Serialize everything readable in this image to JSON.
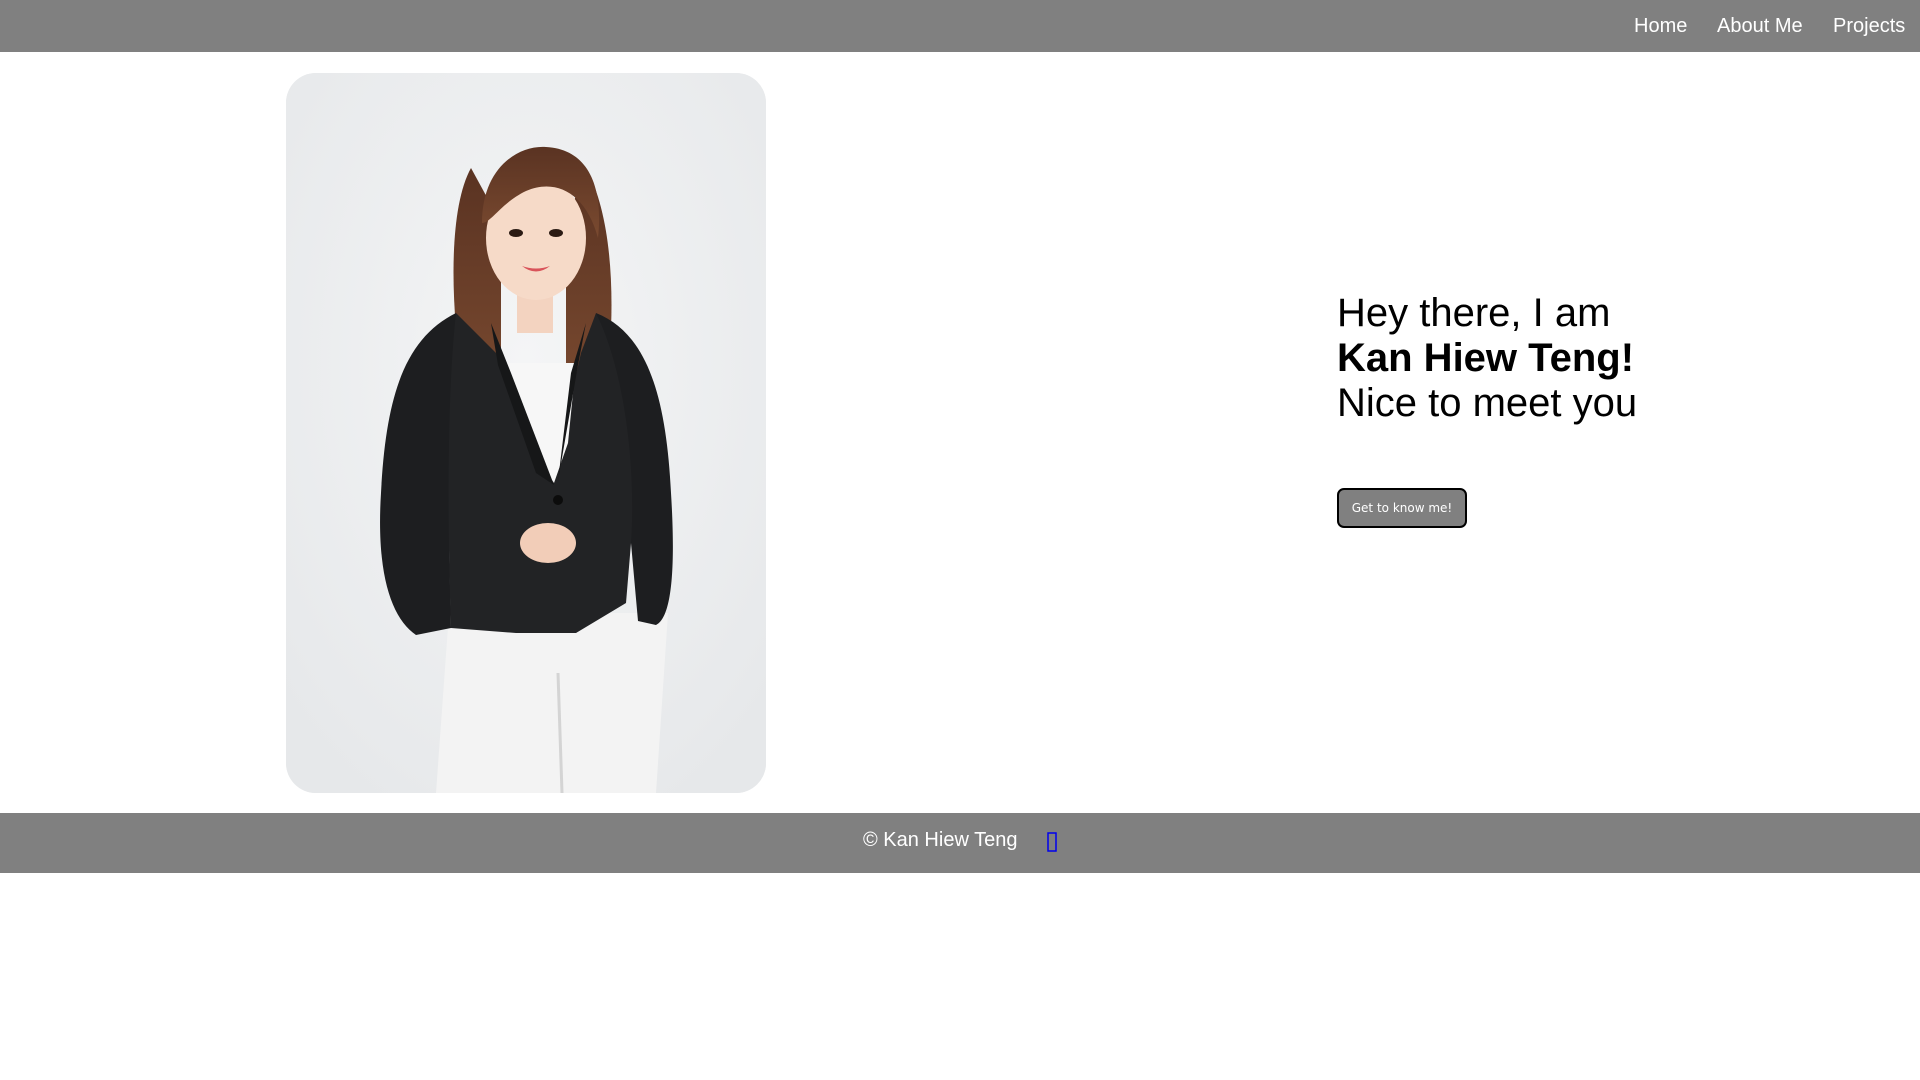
{
  "nav": {
    "items": [
      {
        "label": "Home"
      },
      {
        "label": "About Me"
      },
      {
        "label": "Projects"
      }
    ]
  },
  "hero": {
    "greeting": "Hey there, I am",
    "name": "Kan Hiew Teng!",
    "tagline": "Nice to meet you",
    "button_label": "Get to know me!"
  },
  "portrait": {
    "icon": "profile-photo"
  },
  "footer": {
    "copyright": "© Kan Hiew Teng",
    "link_icon": "missing-glyph-icon"
  },
  "colors": {
    "bar": "#808080",
    "text_light": "#ffffff",
    "text_dark": "#000000",
    "icon_link": "#0000ee"
  }
}
